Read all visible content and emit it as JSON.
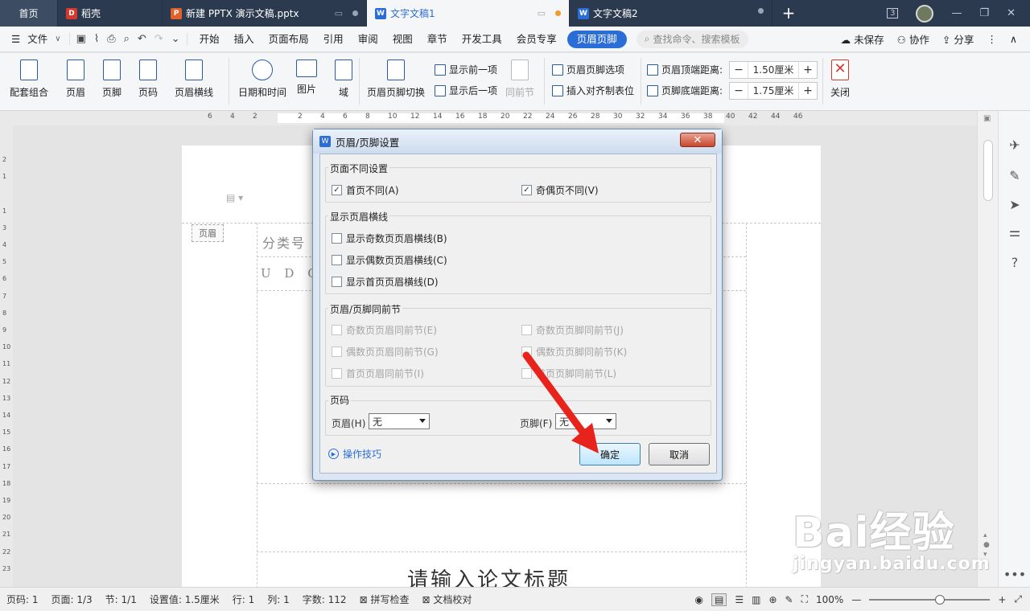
{
  "tabs": {
    "home": "首页",
    "items": [
      {
        "label": "稻壳",
        "icon_color": "#d33a2c",
        "icon_glyph": "D"
      },
      {
        "label": "新建 PPTX 演示文稿.pptx",
        "icon_color": "#e0612a",
        "icon_glyph": "P"
      },
      {
        "label": "文字文稿1",
        "icon_color": "#2a6dd7",
        "icon_glyph": "W"
      },
      {
        "label": "文字文稿2",
        "icon_color": "#2a6dd7",
        "icon_glyph": "W"
      }
    ],
    "plus": "+",
    "badge": "3"
  },
  "menu": {
    "file": "文件",
    "items": [
      "开始",
      "插入",
      "页面布局",
      "引用",
      "审阅",
      "视图",
      "章节",
      "开发工具",
      "会员专享"
    ],
    "active": "页眉页脚",
    "search_placeholder": "查找命令、搜索模板",
    "right": [
      "未保存",
      "协作",
      "分享"
    ]
  },
  "ribbon": {
    "buttons": [
      "配套组合",
      "页眉",
      "页脚",
      "页码",
      "页眉横线",
      "日期和时间",
      "图片",
      "域",
      "页眉页脚切换"
    ],
    "prev": "显示前一项",
    "next": "显示后一项",
    "same_prev": "同前节",
    "options": "页眉页脚选项",
    "align_tab": "插入对齐制表位",
    "top_dist_label": "页眉顶端距离:",
    "top_dist_value": "1.50厘米",
    "bottom_dist_label": "页脚底端距离:",
    "bottom_dist_value": "1.75厘米",
    "close": "关闭"
  },
  "ruler": {
    "h": [
      "6",
      "4",
      "2",
      "",
      "2",
      "4",
      "6",
      "8",
      "10",
      "12",
      "14",
      "16",
      "18",
      "20",
      "22",
      "24",
      "26",
      "28",
      "30",
      "32",
      "34",
      "36",
      "38",
      "40",
      "42",
      "44",
      "46"
    ],
    "v": [
      "2",
      "1",
      "",
      "1",
      "3",
      "4",
      "5",
      "6",
      "7",
      "8",
      "9",
      "10",
      "11",
      "12",
      "13",
      "14",
      "15",
      "16",
      "17",
      "18",
      "19",
      "20",
      "21",
      "22",
      "23"
    ]
  },
  "document": {
    "header_tag": "页眉",
    "class_no": "分类号",
    "udc": "U D C",
    "title": "请输入论文标题"
  },
  "dialog": {
    "title": "页眉/页脚设置",
    "group1": "页面不同设置",
    "first_page_diff": "首页不同(A)",
    "odd_even_diff": "奇偶页不同(V)",
    "group2": "显示页眉横线",
    "show_odd_line": "显示奇数页页眉横线(B)",
    "show_even_line": "显示偶数页页眉横线(C)",
    "show_first_line": "显示首页页眉横线(D)",
    "group3": "页眉/页脚同前节",
    "odd_header_same": "奇数页页眉同前节(E)",
    "odd_footer_same": "奇数页页脚同前节(J)",
    "even_header_same": "偶数页页眉同前节(G)",
    "even_footer_same": "偶数页页脚同前节(K)",
    "first_header_same": "首页页眉同前节(I)",
    "first_footer_same": "首页页脚同前节(L)",
    "group4": "页码",
    "header_label": "页眉(H)",
    "header_value": "无",
    "footer_label": "页脚(F)",
    "footer_value": "无",
    "tips": "操作技巧",
    "ok": "确定",
    "cancel": "取消"
  },
  "status": {
    "page_no": "页码: 1",
    "page": "页面: 1/3",
    "section": "节: 1/1",
    "setting": "设置值: 1.5厘米",
    "row": "行: 1",
    "col": "列: 1",
    "words": "字数: 112",
    "spell": "拼写检查",
    "proof": "文档校对",
    "zoom": "100%",
    "zoom_level": 1.0
  },
  "watermark": {
    "big": "Bai经验",
    "small": "jingyan.baidu.com"
  },
  "colors": {
    "accent": "#2a6dd7",
    "tabbar": "#2b3a4e",
    "arrow": "#e8231c"
  }
}
